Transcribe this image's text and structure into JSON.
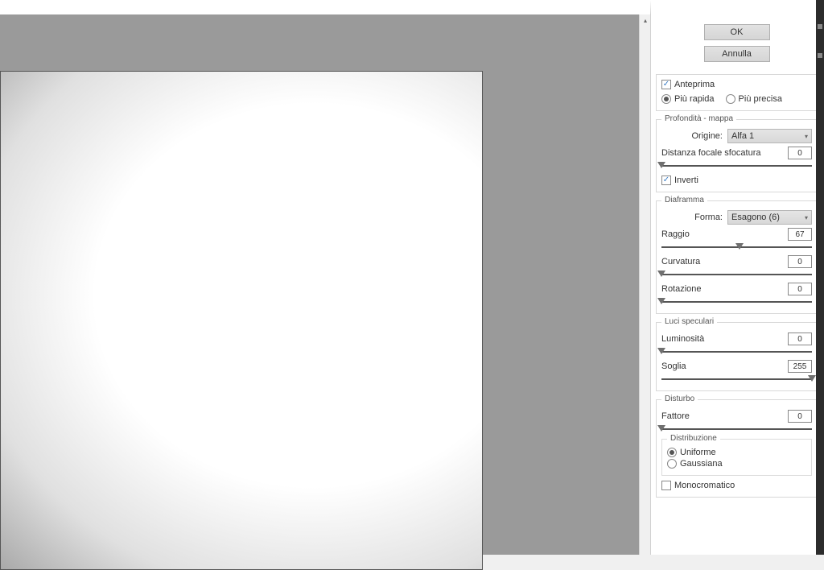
{
  "buttons": {
    "ok": "OK",
    "cancel": "Annulla"
  },
  "preview": {
    "anteprima": "Anteprima",
    "faster": "Più rapida",
    "precise": "Più precisa"
  },
  "depth": {
    "title": "Profondità - mappa",
    "origine_label": "Origine:",
    "origine_value": "Alfa 1",
    "focal_label": "Distanza focale sfocatura",
    "focal_value": "0",
    "invert": "Inverti"
  },
  "iris": {
    "title": "Diaframma",
    "forma_label": "Forma:",
    "forma_value": "Esagono (6)",
    "radius_label": "Raggio",
    "radius_value": "67",
    "curvature_label": "Curvatura",
    "curvature_value": "0",
    "rotation_label": "Rotazione",
    "rotation_value": "0"
  },
  "specular": {
    "title": "Luci speculari",
    "brightness_label": "Luminosità",
    "brightness_value": "0",
    "threshold_label": "Soglia",
    "threshold_value": "255"
  },
  "noise": {
    "title": "Disturbo",
    "amount_label": "Fattore",
    "amount_value": "0",
    "dist_title": "Distribuzione",
    "uniform": "Uniforme",
    "gaussian": "Gaussiana",
    "mono": "Monocromatico"
  }
}
